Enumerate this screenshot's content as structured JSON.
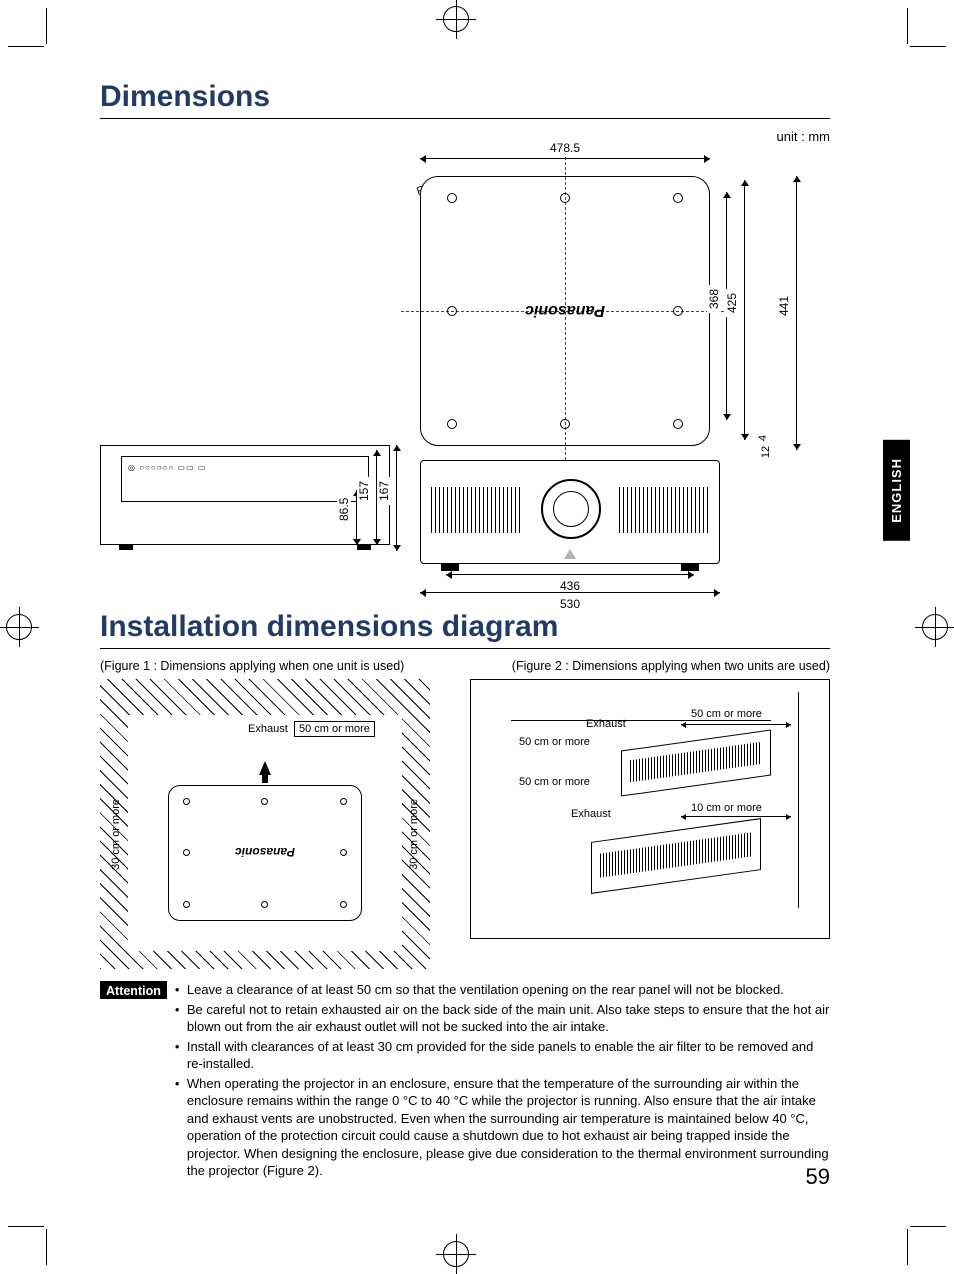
{
  "headings": {
    "dimensions": "Dimensions",
    "installation": "Installation dimensions diagram"
  },
  "unit_label": "unit : mm",
  "brand": "Panasonic",
  "dims": {
    "top_width": "478.5",
    "r30": "R30",
    "v368": "368",
    "v425": "425",
    "v441": "441",
    "v4": "4",
    "v12": "12",
    "rear_86_5": "86.5",
    "rear_157": "157",
    "rear_167": "167",
    "front_436": "436",
    "front_530": "530"
  },
  "fig1": {
    "caption": "(Figure 1 : Dimensions applying when one unit is used)",
    "exhaust": "Exhaust",
    "clearance_50": "50 cm or more",
    "clearance_30": "30 cm or more"
  },
  "fig2": {
    "caption": "(Figure 2 : Dimensions applying when two units are used)",
    "exhaust": "Exhaust",
    "clearance_50": "50 cm or more",
    "clearance_10": "10 cm or more"
  },
  "attention": {
    "label": "Attention",
    "items": [
      "Leave a clearance of at least 50 cm so that the ventilation opening on the rear panel will not be blocked.",
      "Be careful not to retain exhausted air on the back side of the main unit. Also take steps to ensure that the hot air blown out from the air exhaust outlet will not be sucked into the air intake.",
      "Install with clearances of at least 30 cm provided for the side panels to enable the air filter to be removed and re-installed.",
      "When operating the projector in an enclosure, ensure that the temperature of the surrounding air within the enclosure remains within the range 0 °C to 40 °C while the projector is running. Also ensure that the air intake and exhaust vents are unobstructed. Even when the surrounding air temperature is maintained below 40 °C, operation of the protection circuit could cause a shutdown due to hot exhaust air being trapped inside the projector. When designing the enclosure, please give due consideration to the thermal environment surrounding the projector (Figure 2)."
    ]
  },
  "side_tab": "ENGLISH",
  "page_number": "59"
}
